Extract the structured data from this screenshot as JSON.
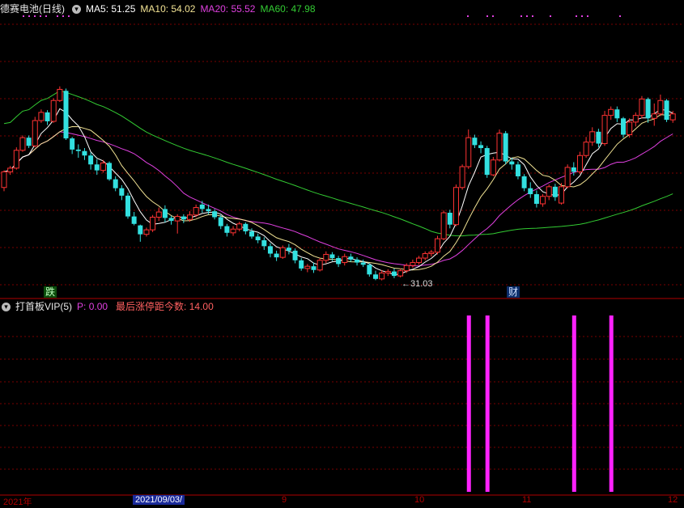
{
  "main_panel": {
    "stock_name": "德赛电池",
    "period": "(日线)",
    "ma_labels": [
      {
        "text": "MA5: 51.25",
        "color": "#ffffff"
      },
      {
        "text": "MA10: 54.02",
        "color": "#f2e394"
      },
      {
        "text": "MA20: 55.52",
        "color": "#e040e0"
      },
      {
        "text": "MA60: 47.98",
        "color": "#33cc33"
      }
    ],
    "low_label": "31.03",
    "marker_die": "跌",
    "marker_cai": "财"
  },
  "indicator_panel": {
    "name": "打首板VIP(5)",
    "p_label": "P: 0.00",
    "last_limit_label": "最后涨停距今数: 14.00"
  },
  "date_axis": {
    "left_label": "2021年",
    "highlight_label": "2021/09/03/",
    "tick_labels": [
      "9",
      "10",
      "11",
      "12"
    ]
  },
  "colors": {
    "up": "#ff3333",
    "down": "#33e0e0",
    "ma5": "#ffffff",
    "ma10": "#f2e394",
    "ma20": "#e040e0",
    "ma60": "#33cc33",
    "signal": "#ff22ff",
    "grid": "#7a0000"
  },
  "chart_data": {
    "type": "candlestick",
    "price_range": [
      29,
      66
    ],
    "candles": [
      [
        43.5,
        45.6,
        43.0,
        45.8
      ],
      [
        45.6,
        46.1,
        45.2,
        46.4
      ],
      [
        46.1,
        48.5,
        45.9,
        48.9
      ],
      [
        48.5,
        50.2,
        48.3,
        50.5
      ],
      [
        50.2,
        49.1,
        48.8,
        50.5
      ],
      [
        49.1,
        52.5,
        48.9,
        53.0
      ],
      [
        52.5,
        53.6,
        52.2,
        54.0
      ],
      [
        53.6,
        52.4,
        51.9,
        53.9
      ],
      [
        52.4,
        55.2,
        52.2,
        55.5
      ],
      [
        55.2,
        56.7,
        55.0,
        57.1
      ],
      [
        56.5,
        50.1,
        49.9,
        56.8
      ],
      [
        50.1,
        48.6,
        48.0,
        50.3
      ],
      [
        48.6,
        48.4,
        47.5,
        49.3
      ],
      [
        48.4,
        47.8,
        47.2,
        48.8
      ],
      [
        47.8,
        46.6,
        45.9,
        48.2
      ],
      [
        46.6,
        45.8,
        45.2,
        47.3
      ],
      [
        45.8,
        46.8,
        45.5,
        47.2
      ],
      [
        46.8,
        44.6,
        44.4,
        47.0
      ],
      [
        44.6,
        43.4,
        43.0,
        45.0
      ],
      [
        43.4,
        42.4,
        41.8,
        43.8
      ],
      [
        42.4,
        39.6,
        39.3,
        42.8
      ],
      [
        39.6,
        38.6,
        38.4,
        40.2
      ],
      [
        38.4,
        37.2,
        36.2,
        38.5
      ],
      [
        37.2,
        37.8,
        36.9,
        38.1
      ],
      [
        37.8,
        39.5,
        37.5,
        39.8
      ],
      [
        39.5,
        40.2,
        39.0,
        40.8
      ],
      [
        40.6,
        39.4,
        38.8,
        41.1
      ],
      [
        39.4,
        39.0,
        38.5,
        39.7
      ],
      [
        39.0,
        39.6,
        37.3,
        39.9
      ],
      [
        39.6,
        39.2,
        38.7,
        39.9
      ],
      [
        39.2,
        39.8,
        38.9,
        40.3
      ],
      [
        39.8,
        40.8,
        39.5,
        41.2
      ],
      [
        41.2,
        40.6,
        40.1,
        41.7
      ],
      [
        40.6,
        40.3,
        39.9,
        41.2
      ],
      [
        40.3,
        39.5,
        39.2,
        40.6
      ],
      [
        39.5,
        38.3,
        37.9,
        39.8
      ],
      [
        38.3,
        37.4,
        36.9,
        38.6
      ],
      [
        37.4,
        37.9,
        37.0,
        38.3
      ],
      [
        37.9,
        38.6,
        37.6,
        38.9
      ],
      [
        38.6,
        37.6,
        37.2,
        38.8
      ],
      [
        37.6,
        36.9,
        36.6,
        38.0
      ],
      [
        36.9,
        36.4,
        36.0,
        37.3
      ],
      [
        36.4,
        35.6,
        35.1,
        36.8
      ],
      [
        35.6,
        34.6,
        34.1,
        36.0
      ],
      [
        34.6,
        34.1,
        33.6,
        35.0
      ],
      [
        34.1,
        35.4,
        33.9,
        35.7
      ],
      [
        35.4,
        35.0,
        34.5,
        35.9
      ],
      [
        35.0,
        33.7,
        33.3,
        35.3
      ],
      [
        33.7,
        32.6,
        32.3,
        34.0
      ],
      [
        32.6,
        32.9,
        32.1,
        33.2
      ],
      [
        32.9,
        32.4,
        32.0,
        33.4
      ],
      [
        32.4,
        33.7,
        32.2,
        34.0
      ],
      [
        33.7,
        34.5,
        33.3,
        34.9
      ],
      [
        34.5,
        34.0,
        33.6,
        34.8
      ],
      [
        34.0,
        33.2,
        32.8,
        34.3
      ],
      [
        33.4,
        34.2,
        33.0,
        34.6
      ],
      [
        34.2,
        33.8,
        33.5,
        34.6
      ],
      [
        33.8,
        33.4,
        33.0,
        34.1
      ],
      [
        33.4,
        33.1,
        32.8,
        33.8
      ],
      [
        33.1,
        31.8,
        31.5,
        33.3
      ],
      [
        31.8,
        31.2,
        31.03,
        32.3
      ],
      [
        31.2,
        32.0,
        31.0,
        32.4
      ],
      [
        32.0,
        32.2,
        31.6,
        32.5
      ],
      [
        32.2,
        31.6,
        31.3,
        32.6
      ],
      [
        31.6,
        32.3,
        31.4,
        32.6
      ],
      [
        32.3,
        33.0,
        32.0,
        33.3
      ],
      [
        33.0,
        33.4,
        32.7,
        33.8
      ],
      [
        33.4,
        34.0,
        33.1,
        34.3
      ],
      [
        34.0,
        34.6,
        33.7,
        34.9
      ],
      [
        34.6,
        34.8,
        34.2,
        35.1
      ],
      [
        34.8,
        36.6,
        34.5,
        37.0
      ],
      [
        36.6,
        40.1,
        36.4,
        40.4
      ],
      [
        40.1,
        38.5,
        38.0,
        40.5
      ],
      [
        38.5,
        43.5,
        38.3,
        43.9
      ],
      [
        43.5,
        46.3,
        43.2,
        46.6
      ],
      [
        46.3,
        50.2,
        46.0,
        51.3
      ],
      [
        50.2,
        49.2,
        48.8,
        50.6
      ],
      [
        49.2,
        48.8,
        48.1,
        49.7
      ],
      [
        48.8,
        45.2,
        44.8,
        49.1
      ],
      [
        45.2,
        47.2,
        45.0,
        47.6
      ],
      [
        47.2,
        50.8,
        47.0,
        51.3
      ],
      [
        50.8,
        47.0,
        46.6,
        51.1
      ],
      [
        47.0,
        46.6,
        45.9,
        47.5
      ],
      [
        46.6,
        45.0,
        44.6,
        47.0
      ],
      [
        45.0,
        43.4,
        43.0,
        45.3
      ],
      [
        43.4,
        42.6,
        42.1,
        44.2
      ],
      [
        42.6,
        41.3,
        40.8,
        43.1
      ],
      [
        41.3,
        42.3,
        40.9,
        42.6
      ],
      [
        42.3,
        43.6,
        41.8,
        43.9
      ],
      [
        43.6,
        42.2,
        41.7,
        44.0
      ],
      [
        41.4,
        43.6,
        41.2,
        44.1
      ],
      [
        43.6,
        46.2,
        43.4,
        46.6
      ],
      [
        46.2,
        45.6,
        45.1,
        46.9
      ],
      [
        45.6,
        47.8,
        45.3,
        48.3
      ],
      [
        47.8,
        49.6,
        47.5,
        50.3
      ],
      [
        49.6,
        51.0,
        49.1,
        51.6
      ],
      [
        51.0,
        49.4,
        48.9,
        51.4
      ],
      [
        49.4,
        53.2,
        49.1,
        53.8
      ],
      [
        53.2,
        54.0,
        52.6,
        54.4
      ],
      [
        54.0,
        52.8,
        52.3,
        54.4
      ],
      [
        52.8,
        50.6,
        50.2,
        53.0
      ],
      [
        50.6,
        52.3,
        50.2,
        52.8
      ],
      [
        52.3,
        53.2,
        51.7,
        53.6
      ],
      [
        53.2,
        55.4,
        52.8,
        55.8
      ],
      [
        55.4,
        52.8,
        52.2,
        55.6
      ],
      [
        52.8,
        53.4,
        51.8,
        54.8
      ],
      [
        53.4,
        55.2,
        53.1,
        56.0
      ],
      [
        55.2,
        52.6,
        52.3,
        55.4
      ],
      [
        52.6,
        53.4,
        52.2,
        53.8
      ]
    ],
    "ma_periods": [
      5,
      10,
      20,
      60
    ],
    "signals": [
      {
        "index": 70,
        "value": 1
      },
      {
        "index": 73,
        "value": 1
      },
      {
        "index": 87,
        "value": 1
      },
      {
        "index": 93,
        "value": 1
      }
    ]
  }
}
